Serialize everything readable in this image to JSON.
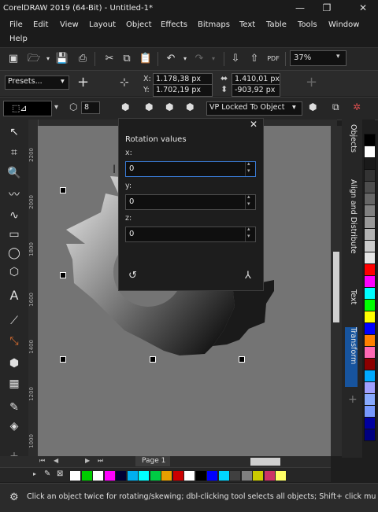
{
  "window": {
    "title": "CorelDRAW 2019 (64-Bit) - Untitled-1*",
    "minimize": "—",
    "restore": "❐",
    "close": "✕"
  },
  "menu": [
    "File",
    "Edit",
    "View",
    "Layout",
    "Object",
    "Effects",
    "Bitmaps",
    "Text",
    "Table",
    "Tools",
    "Window",
    "Help"
  ],
  "toolbar": {
    "zoom": "37%"
  },
  "property_bar": {
    "presets": "Presets...",
    "x_label": "X:",
    "x_value": "1.178,38 px",
    "y_label": "Y:",
    "y_value": "1.702,19 px",
    "w_value": "1.410,01 px",
    "h_value": "-903,92 px"
  },
  "property_bar2": {
    "depth_value": "8",
    "vp_mode": "VP Locked To Object"
  },
  "rotation_dialog": {
    "title": "Rotation values",
    "x_label": "x:",
    "x_value": "0",
    "y_label": "y:",
    "y_value": "0",
    "z_label": "z:",
    "z_value": "0"
  },
  "dockers": [
    "Objects",
    "Align and Distribute",
    "Text",
    "Transform"
  ],
  "ruler_vertical_labels": [
    "2200",
    "2000",
    "1800",
    "1600",
    "1400",
    "1200",
    "1000"
  ],
  "page_tab": "Page 1",
  "status_text": "Click an object twice for rotating/skewing; dbl-clicking tool selects all objects; Shift+ click multi-sel",
  "palette_vertical": [
    "#000000",
    "#ffffff",
    "#1a1a1a",
    "#333333",
    "#4d4d4d",
    "#666666",
    "#808080",
    "#999999",
    "#b3b3b3",
    "#cccccc",
    "#e6e6e6",
    "#ff0000",
    "#ff00ff",
    "#00ffff",
    "#00ff00",
    "#ffff00",
    "#0000ff",
    "#ff8000",
    "#ff69b4",
    "#8b0000",
    "#00aaff",
    "#a0a0ff",
    "#88aaff",
    "#7799ff",
    "#0000a0",
    "#000080"
  ],
  "palette_horizontal": [
    "#ffffff",
    "#00cc00",
    "#ffffff",
    "#ff00ff",
    "#000033",
    "#00b0f0",
    "#00ffff",
    "#00cc44",
    "#e8a000",
    "#cc0000",
    "#ffffff",
    "#000000",
    "#0000ff",
    "#00d4ff",
    "#404040",
    "#808080",
    "#cccc00",
    "#cc3366",
    "#ffff66"
  ]
}
